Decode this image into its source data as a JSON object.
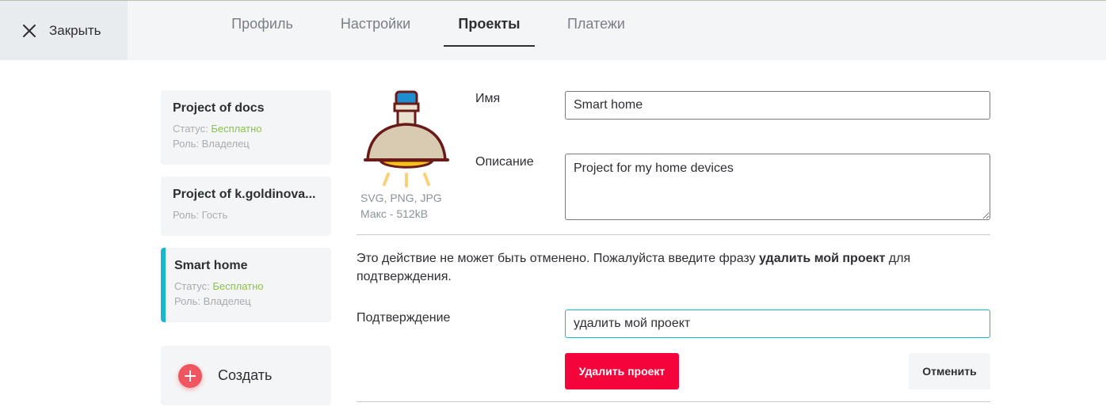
{
  "header": {
    "close_label": "Закрыть",
    "tabs": [
      {
        "label": "Профиль"
      },
      {
        "label": "Настройки"
      },
      {
        "label": "Проекты"
      },
      {
        "label": "Платежи"
      }
    ],
    "active_tab": "Проекты"
  },
  "projects": [
    {
      "title": "Project of docs",
      "status_label": "Статус:",
      "status_value": "Бесплатно",
      "role": "Роль: Владелец"
    },
    {
      "title": "Project of k.goldinova...",
      "role": "Роль: Гость"
    },
    {
      "title": "Smart home",
      "status_label": "Статус:",
      "status_value": "Бесплатно",
      "role": "Роль: Владелец",
      "selected": true
    }
  ],
  "create_label": "Создать",
  "icon": {
    "name": "lamp-icon",
    "formats_hint": "SVG, PNG, JPG",
    "size_hint": "Макс - 512kB"
  },
  "form": {
    "name_label": "Имя",
    "name_value": "Smart home",
    "description_label": "Описание",
    "description_value": "Project for my home devices"
  },
  "delete": {
    "warning_prefix": "Это действие не может быть отменено. Пожалуйста введите фразу ",
    "phrase": "удалить мой проект",
    "warning_suffix": " для подтверждения.",
    "confirm_label": "Подтверждение",
    "confirm_value": "удалить мой проект",
    "delete_button": "Удалить проект",
    "cancel_button": "Отменить"
  },
  "colors": {
    "accent": "#18b7c9",
    "danger": "#f4043a",
    "free_status": "#8cc152",
    "create_plus": "#f05660"
  }
}
